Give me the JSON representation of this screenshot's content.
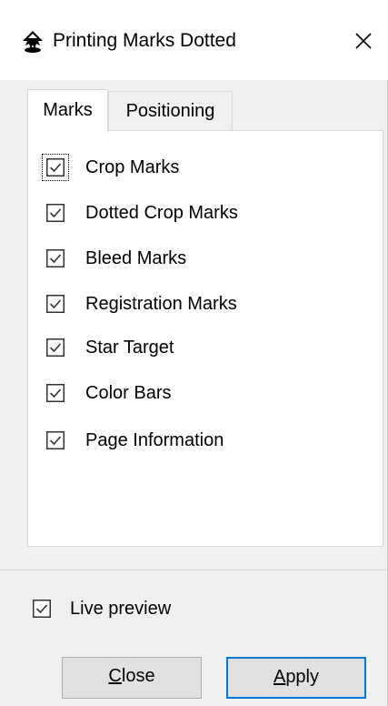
{
  "window": {
    "title": "Printing Marks Dotted",
    "icon": "inkscape-logo-icon",
    "close_icon": "close-icon"
  },
  "tabs": [
    {
      "label": "Marks",
      "selected": true
    },
    {
      "label": "Positioning",
      "selected": false
    }
  ],
  "marks": [
    {
      "label": "Crop Marks",
      "checked": true,
      "focused": true
    },
    {
      "label": "Dotted Crop Marks",
      "checked": true
    },
    {
      "label": "Bleed Marks",
      "checked": true
    },
    {
      "label": "Registration Marks",
      "checked": true
    },
    {
      "label": "Star Target",
      "checked": true
    },
    {
      "label": "Color Bars",
      "checked": true
    },
    {
      "label": "Page Information",
      "checked": true
    }
  ],
  "live_preview": {
    "label": "Live preview",
    "checked": true
  },
  "buttons": {
    "close": {
      "mnemonic": "C",
      "rest": "lose"
    },
    "apply": {
      "mnemonic": "A",
      "rest": "pply"
    }
  },
  "colors": {
    "accent": "#0078d7",
    "checkbox_border": "#333333"
  }
}
